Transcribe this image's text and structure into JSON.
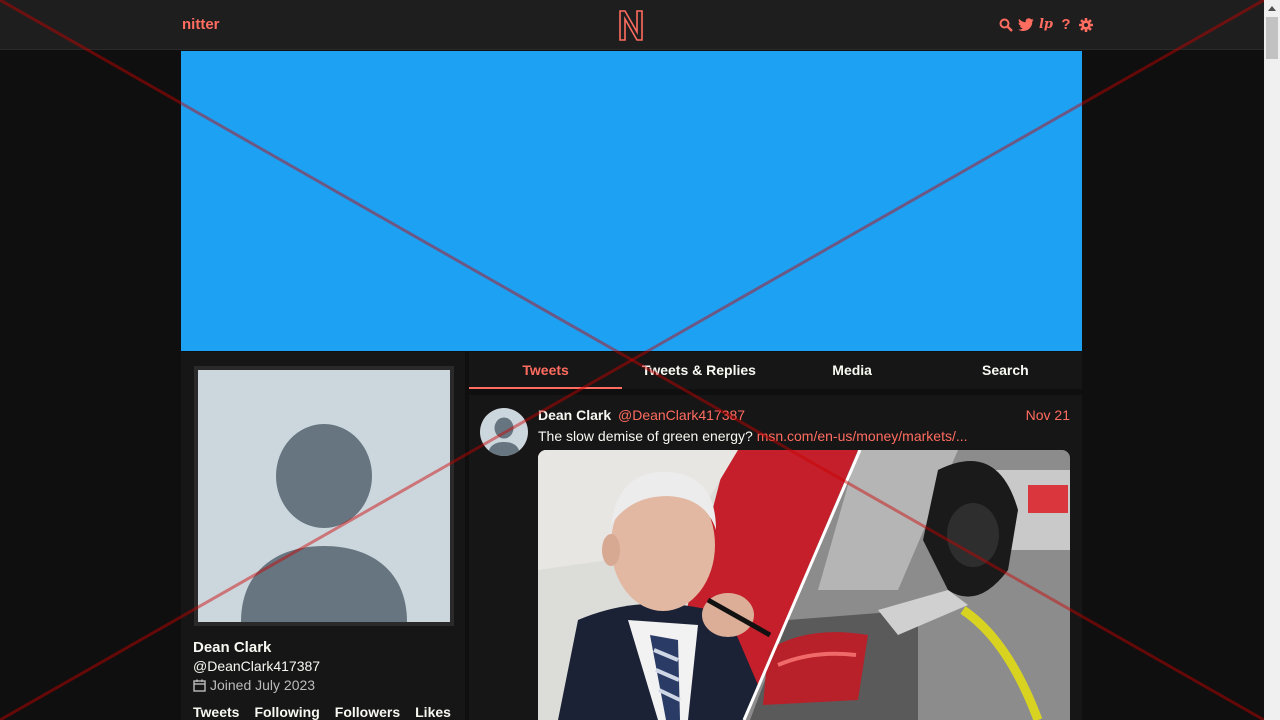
{
  "nav": {
    "brand": "nitter",
    "logo_letter": "N",
    "icons": [
      "search-icon",
      "twitter-icon",
      "lp-icon",
      "help-icon",
      "gear-icon"
    ],
    "lp_text": "lp",
    "help_text": "?"
  },
  "banner": {
    "color": "#1da1f2"
  },
  "profile": {
    "name": "Dean Clark",
    "handle": "@DeanClark417387",
    "joined": "Joined July 2023",
    "stats": [
      "Tweets",
      "Following",
      "Followers",
      "Likes"
    ]
  },
  "tabs": [
    "Tweets",
    "Tweets & Replies",
    "Media",
    "Search"
  ],
  "active_tab": "Tweets",
  "tweet": {
    "author": "Dean Clark",
    "handle": "@DeanClark417387",
    "date": "Nov 21",
    "text": "The slow demise of green energy?",
    "link": "msn.com/en-us/money/markets/..."
  },
  "colors": {
    "accent": "#ff6c60",
    "background": "#0f0f0f",
    "panel": "#161616",
    "navbar": "#1e1e1e"
  }
}
